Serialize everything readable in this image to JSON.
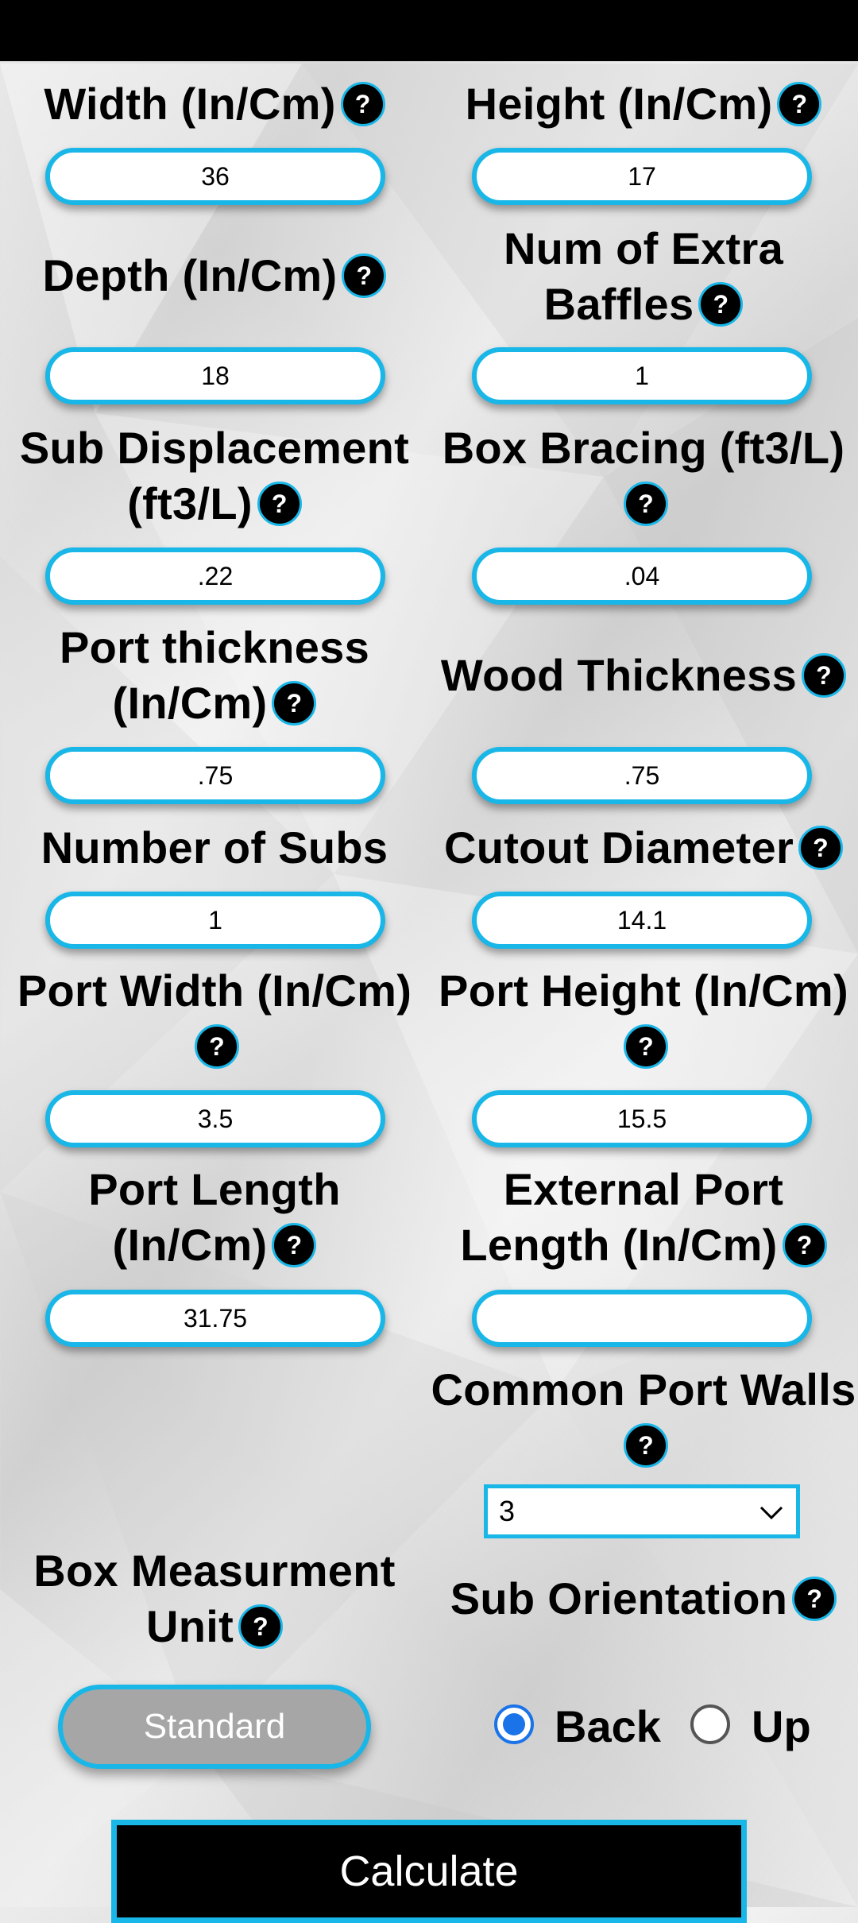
{
  "fields": {
    "width": {
      "label": "Width (In/Cm)",
      "value": "36"
    },
    "height": {
      "label": "Height (In/Cm)",
      "value": "17"
    },
    "depth": {
      "label": "Depth (In/Cm)",
      "value": "18"
    },
    "extra_baffles": {
      "label_line1": "Num of Extra",
      "label_line2": "Baffles",
      "value": "1"
    },
    "sub_displacement": {
      "label_line1": "Sub Displacement",
      "label_line2": "(ft3/L)",
      "value": ".22"
    },
    "box_bracing": {
      "label": "Box Bracing (ft3/L)",
      "value": ".04"
    },
    "port_thickness": {
      "label_line1": "Port thickness",
      "label_line2": "(In/Cm)",
      "value": ".75"
    },
    "wood_thickness": {
      "label": "Wood Thickness",
      "value": ".75"
    },
    "number_of_subs": {
      "label": "Number of Subs",
      "value": "1"
    },
    "cutout_diameter": {
      "label": "Cutout Diameter",
      "value": "14.1"
    },
    "port_width": {
      "label": "Port Width (In/Cm)",
      "value": "3.5"
    },
    "port_height": {
      "label": "Port Height (In/Cm)",
      "value": "15.5"
    },
    "port_length": {
      "label_line1": "Port Length",
      "label_line2": "(In/Cm)",
      "value": "31.75"
    },
    "external_port_length": {
      "label_line1": "External Port",
      "label_line2": "Length (In/Cm)",
      "value": ""
    }
  },
  "common_port_walls": {
    "label": "Common Port Walls",
    "selected": "3"
  },
  "box_unit": {
    "label_line1": "Box Measurment",
    "label_line2": "Unit",
    "button": "Standard"
  },
  "sub_orientation": {
    "label": "Sub Orientation",
    "options": [
      "Back",
      "Up"
    ],
    "selected": "Back"
  },
  "help_glyph": "?",
  "calculate_label": "Calculate",
  "colors": {
    "accent": "#19b6e8",
    "radio": "#1a73e8",
    "button_gray": "#a6a6a6"
  }
}
